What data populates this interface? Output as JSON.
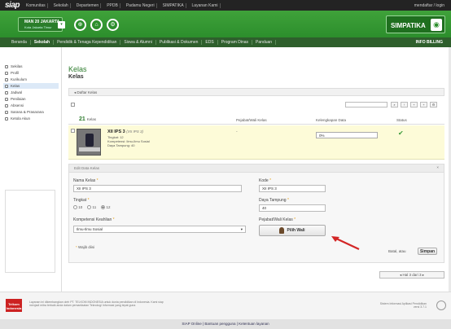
{
  "topbar": {
    "logo": "siap",
    "nav": [
      "Komunitas",
      "Sekolah",
      "Departemen",
      "PPDB",
      "Padamu Negeri",
      "SIMPATIKA",
      "Layanan Kami"
    ],
    "login": "mendaftar / login"
  },
  "header": {
    "school_name": "MAN 20 JAKARTA",
    "school_location": "Kota Jakarta Timur",
    "simpatika": "SIMPATIKA"
  },
  "mainnav": {
    "items": [
      "Beranda",
      "Sekolah",
      "Pendidik & Tenaga Kependidikan",
      "Siswa & Alumni",
      "Publikasi & Dokumen",
      "EDS",
      "Program Dinas",
      "Panduan"
    ],
    "billing": "INFO BILLING"
  },
  "sidebar": {
    "items": [
      "Sekilas",
      "Profil",
      "Kurikulum",
      "Kelas",
      "Jadwal",
      "Penilaian",
      "Absensi",
      "Sarana & Prasarana",
      "Ketola Akun"
    ]
  },
  "content": {
    "title": "Kelas",
    "subtitle": "Kelas",
    "breadcrumb": "Daftar Kelas",
    "count": "21",
    "count_label": "Kelas",
    "columns": [
      "Pejabat/Wali Kelas",
      "Kelengkapan Data",
      "Status"
    ],
    "row": {
      "name": "XII IPS 3",
      "name_alt": "(XII IPS 3)",
      "tingkat": "Tingkat: 12",
      "kompetensi": "Kompetensi: Ilmu-Ilmu Sosial",
      "daya": "Daya Tampung: 40",
      "wali": "-",
      "progress": "0%",
      "progress_value": 0
    }
  },
  "edit": {
    "title": "Edit Data Kelas",
    "nama_label": "Nama Kelas",
    "nama_value": "XII IPS 3",
    "kode_label": "Kode",
    "kode_value": "XII IPS 3",
    "tingkat_label": "Tingkat",
    "tingkat_options": [
      "10",
      "11",
      "12"
    ],
    "tingkat_selected": "12",
    "daya_label": "Daya Tampung",
    "daya_value": "40",
    "kompetensi_label": "Kompetensi Keahlian",
    "kompetensi_value": "Ilmu-Ilmu Sosial",
    "wali_label": "Pejabat/Wali Kelas",
    "pilih_label": "Pilih Wali",
    "wajib": "Wajib diisi",
    "batal": "Batal, atau",
    "simpan": "Simpan",
    "required_mark": "*"
  },
  "pager": "Hal 3 dari 3",
  "footer": {
    "logo": "Telkom Indonesia",
    "text": "Layanan ini dikembangkan oleh PT. TELKOM INDONESIA untuk dunia pendidikan di Indonesia. Kami siap menjadi mitra terbaik anda dalam pemanfaatan Teknologi Informasi yang tepat guna",
    "right1": "Sistem Informasi Aplikasi Pendidikan",
    "right2": "versi 3.7.1",
    "bottom": "SIAP Online | Bantuan pengguna | Ketentuan layanan"
  },
  "colors": {
    "green": "#2c8e2c",
    "highlight": "#fdfbd8",
    "arrow": "#d32626"
  }
}
